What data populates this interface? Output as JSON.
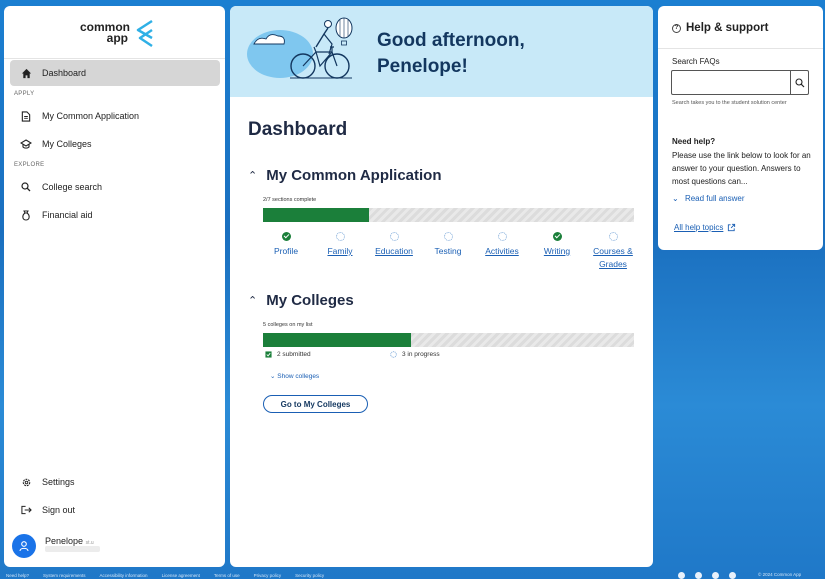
{
  "brand": {
    "line1": "common",
    "line2": "app"
  },
  "sidebar": {
    "dashboard": "Dashboard",
    "section_apply": "APPLY",
    "my_common_app": "My Common Application",
    "my_colleges": "My Colleges",
    "section_explore": "EXPLORE",
    "college_search": "College search",
    "financial_aid": "Financial aid",
    "settings": "Settings",
    "sign_out": "Sign out",
    "user_name": "Penelope",
    "user_suffix": "st.u"
  },
  "banner": {
    "greeting_line1": "Good afternoon,",
    "greeting_line2": "Penelope!"
  },
  "main": {
    "title": "Dashboard",
    "common_app": {
      "heading": "My Common Application",
      "progress_label": "2/7 sections complete",
      "progress_fraction": 0.2857,
      "steps": [
        {
          "label": "Profile",
          "done": true,
          "link": false
        },
        {
          "label": "Family",
          "done": false,
          "link": true
        },
        {
          "label": "Education",
          "done": false,
          "link": true
        },
        {
          "label": "Testing",
          "done": false,
          "link": false
        },
        {
          "label": "Activities",
          "done": false,
          "link": true
        },
        {
          "label": "Writing",
          "done": true,
          "link": true
        },
        {
          "label": "Courses & Grades",
          "done": false,
          "link": true
        }
      ]
    },
    "colleges": {
      "heading": "My Colleges",
      "list_label": "5 colleges on my list",
      "progress_fraction": 0.4,
      "submitted": "2 submitted",
      "in_progress": "3 in progress",
      "show_colleges": "Show colleges",
      "go_button": "Go to My Colleges"
    }
  },
  "help": {
    "title": "Help & support",
    "search_label": "Search FAQs",
    "search_value": "",
    "search_hint": "Search takes you to the student solution center",
    "need_help": "Need help?",
    "need_help_body": "Please use the link below to look for an answer to your question. Answers to most questions can...",
    "read_full": "Read full answer",
    "all_topics": "All help topics"
  },
  "footer": {
    "links": [
      "Need help?",
      "System requirements",
      "Accessibility information",
      "License agreement",
      "Terms of use",
      "Privacy policy",
      "Security policy"
    ],
    "copyright": "© 2024 Common App"
  },
  "colors": {
    "accent": "#1a5fb4",
    "success": "#1b7f3a",
    "banner": "#c8e9f8",
    "background": "#1b7fd1"
  }
}
